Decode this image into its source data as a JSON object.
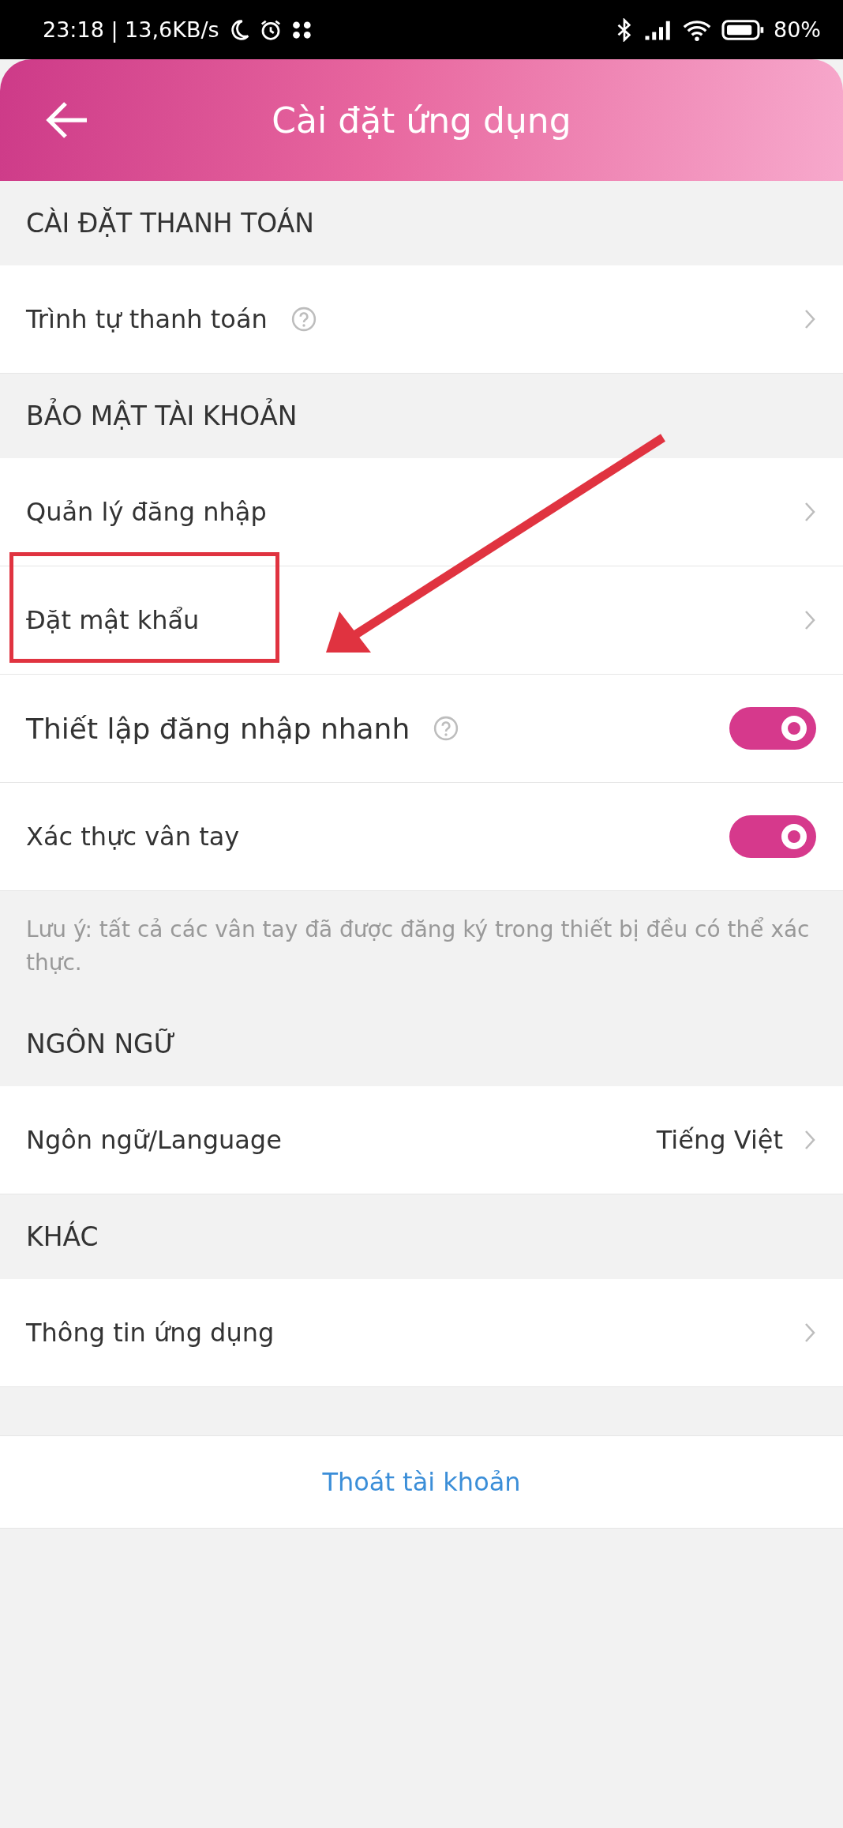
{
  "status_bar": {
    "time": "23:18 | 13,6KB/s",
    "battery": "80%"
  },
  "header": {
    "title": "Cài đặt ứng dụng"
  },
  "sections": [
    {
      "title": "CÀI ĐẶT THANH TOÁN",
      "items": [
        {
          "kind": "link",
          "label": "Trình tự thanh toán",
          "help": true,
          "highlighted": false
        }
      ]
    },
    {
      "title": "BẢO MẬT TÀI KHOẢN",
      "items": [
        {
          "kind": "link",
          "label": "Quản lý đăng nhập",
          "help": false,
          "highlighted": false
        },
        {
          "kind": "link",
          "label": "Đặt mật khẩu",
          "help": false,
          "highlighted": true
        },
        {
          "kind": "toggle",
          "label": "Thiết lập đăng nhập nhanh",
          "help": true,
          "highlighted": false,
          "on": true
        },
        {
          "kind": "toggle",
          "label": "Xác thực vân tay",
          "help": false,
          "highlighted": false,
          "on": true
        }
      ],
      "note": "Lưu ý: tất cả các vân tay đã được đăng ký trong thiết bị đều có thể xác thực."
    },
    {
      "title": "NGÔN NGỮ",
      "items": [
        {
          "kind": "link",
          "label": "Ngôn ngữ/Language",
          "value": "Tiếng Việt",
          "help": false,
          "highlighted": false
        }
      ]
    },
    {
      "title": "KHÁC",
      "items": [
        {
          "kind": "link",
          "label": "Thông tin ứng dụng",
          "help": false,
          "highlighted": false
        }
      ]
    }
  ],
  "logout": {
    "label": "Thoát tài khoản"
  }
}
